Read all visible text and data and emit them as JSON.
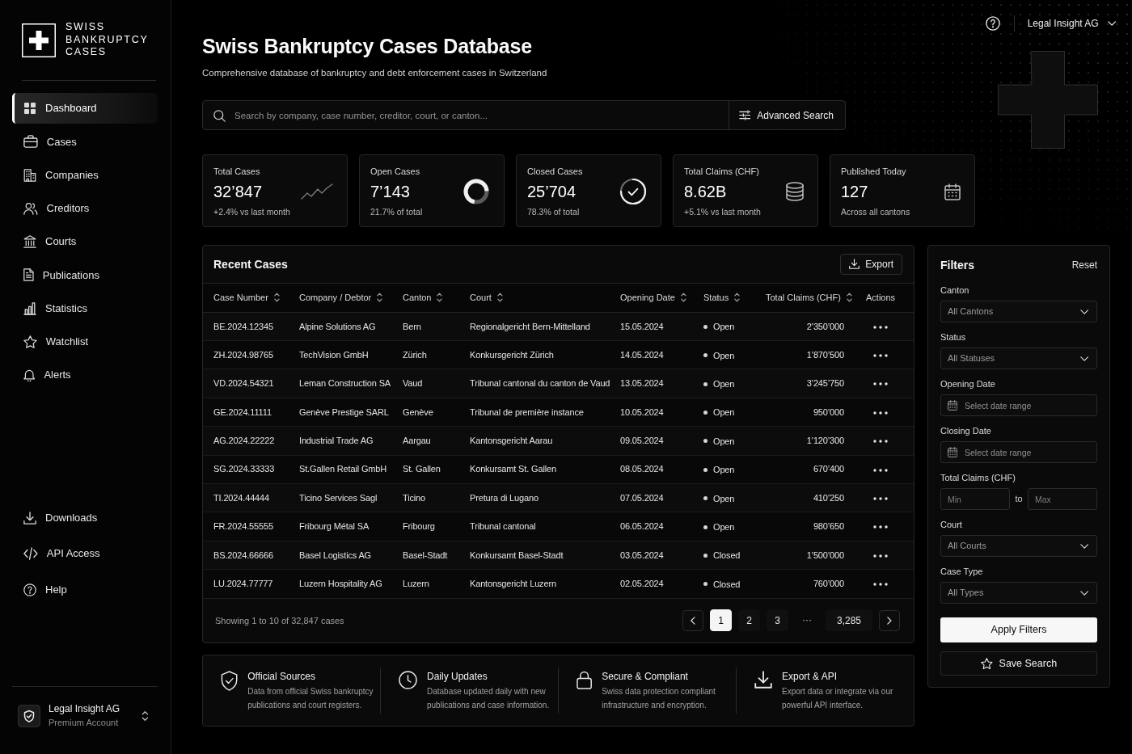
{
  "sidebar": {
    "logo_lines": [
      "SWISS",
      "BANKRUPTCY",
      "CASES"
    ],
    "nav_items": [
      {
        "label": "Dashboard",
        "selected": true
      },
      {
        "label": "Cases",
        "selected": false
      },
      {
        "label": "Companies",
        "selected": false
      },
      {
        "label": "Creditors",
        "selected": false
      },
      {
        "label": "Courts",
        "selected": false
      },
      {
        "label": "Publications",
        "selected": false
      },
      {
        "label": "Statistics",
        "selected": false
      },
      {
        "label": "Watchlist",
        "selected": false
      },
      {
        "label": "Alerts",
        "selected": false
      }
    ],
    "secondary_items": [
      {
        "label": "Downloads",
        "selected": false
      },
      {
        "label": "API Access",
        "selected": false
      },
      {
        "label": "Help",
        "selected": false
      }
    ],
    "account": {
      "name": "Legal Insight AG",
      "plan": "Premium Account"
    }
  },
  "top_bar": {
    "account_name": "Legal Insight AG"
  },
  "header": {
    "title": "Swiss Bankruptcy Cases Database",
    "subtitle": "Comprehensive database of bankruptcy and debt enforcement cases in Switzerland"
  },
  "search": {
    "placeholder": "Search by company, case number, creditor, court, or canton...",
    "advanced_button": "Advanced Search"
  },
  "stats": [
    {
      "label": "Total Cases",
      "value": "32’847",
      "note": "+2.4% vs last month"
    },
    {
      "label": "Open Cases",
      "value": "7’143",
      "note": "21.7% of total"
    },
    {
      "label": "Closed Cases",
      "value": "25’704",
      "note": "78.3% of total"
    },
    {
      "label": "Total Claims (CHF)",
      "value": "8.62B",
      "note": "+5.1% vs last month"
    },
    {
      "label": "Published Today",
      "value": "127",
      "note": "Across all cantons"
    }
  ],
  "table": {
    "title": "Recent Cases",
    "export_button": "Export",
    "columns": [
      {
        "label": "Case Number",
        "sortable": true
      },
      {
        "label": "Company / Debtor",
        "sortable": true
      },
      {
        "label": "Canton",
        "sortable": true
      },
      {
        "label": "Court",
        "sortable": true
      },
      {
        "label": "Opening Date",
        "sortable": true
      },
      {
        "label": "Status",
        "sortable": true
      },
      {
        "label": "Total Claims (CHF)",
        "sortable": true
      },
      {
        "label": "Actions",
        "sortable": false
      }
    ],
    "rows": [
      {
        "case_number": "BE.2024.12345",
        "company": "Alpine Solutions AG",
        "canton": "Bern",
        "court": "Regionalgericht Bern-Mittelland",
        "opening_date": "15.05.2024",
        "status": "Open",
        "total_claims": "2’350’000"
      },
      {
        "case_number": "ZH.2024.98765",
        "company": "TechVision GmbH",
        "canton": "Zürich",
        "court": "Konkursgericht Zürich",
        "opening_date": "14.05.2024",
        "status": "Open",
        "total_claims": "1’870’500"
      },
      {
        "case_number": "VD.2024.54321",
        "company": "Leman Construction SA",
        "canton": "Vaud",
        "court": "Tribunal cantonal du canton de Vaud",
        "opening_date": "13.05.2024",
        "status": "Open",
        "total_claims": "3’245’750"
      },
      {
        "case_number": "GE.2024.11111",
        "company": "Genève Prestige SARL",
        "canton": "Genève",
        "court": "Tribunal de première instance",
        "opening_date": "10.05.2024",
        "status": "Open",
        "total_claims": "950’000"
      },
      {
        "case_number": "AG.2024.22222",
        "company": "Industrial Trade AG",
        "canton": "Aargau",
        "court": "Kantonsgericht Aarau",
        "opening_date": "09.05.2024",
        "status": "Open",
        "total_claims": "1’120’300"
      },
      {
        "case_number": "SG.2024.33333",
        "company": "St.Gallen Retail GmbH",
        "canton": "St. Gallen",
        "court": "Konkursamt St. Gallen",
        "opening_date": "08.05.2024",
        "status": "Open",
        "total_claims": "670’400"
      },
      {
        "case_number": "TI.2024.44444",
        "company": "Ticino Services Sagl",
        "canton": "Ticino",
        "court": "Pretura di Lugano",
        "opening_date": "07.05.2024",
        "status": "Open",
        "total_claims": "410’250"
      },
      {
        "case_number": "FR.2024.55555",
        "company": "Fribourg Métal SA",
        "canton": "Fribourg",
        "court": "Tribunal cantonal",
        "opening_date": "06.05.2024",
        "status": "Open",
        "total_claims": "980’650"
      },
      {
        "case_number": "BS.2024.66666",
        "company": "Basel Logistics AG",
        "canton": "Basel-Stadt",
        "court": "Konkursamt Basel-Stadt",
        "opening_date": "03.05.2024",
        "status": "Closed",
        "total_claims": "1’500’000"
      },
      {
        "case_number": "LU.2024.77777",
        "company": "Luzern Hospitality AG",
        "canton": "Luzern",
        "court": "Kantonsgericht Luzern",
        "opening_date": "02.05.2024",
        "status": "Closed",
        "total_claims": "760’000"
      }
    ],
    "summary": "Showing 1 to 10 of 32,847 cases",
    "pages": [
      {
        "kind": "page",
        "label": "1",
        "selected": true
      },
      {
        "kind": "page",
        "label": "2",
        "selected": false
      },
      {
        "kind": "page",
        "label": "3",
        "selected": false
      },
      {
        "kind": "gap",
        "label": "···",
        "selected": false
      },
      {
        "kind": "page",
        "label": "3,285",
        "selected": false
      }
    ]
  },
  "filters": {
    "title": "Filters",
    "reset": "Reset",
    "fields": [
      {
        "kind": "select",
        "label": "Canton",
        "value": "All Cantons"
      },
      {
        "kind": "select",
        "label": "Status",
        "value": "All Statuses"
      },
      {
        "kind": "date",
        "label": "Opening Date",
        "placeholder": "Select date range"
      },
      {
        "kind": "date",
        "label": "Closing Date",
        "placeholder": "Select date range"
      },
      {
        "kind": "range",
        "label": "Total Claims (CHF)",
        "min_placeholder": "Min",
        "separator": "to",
        "max_placeholder": "Max"
      },
      {
        "kind": "select",
        "label": "Court",
        "value": "All Courts"
      },
      {
        "kind": "select",
        "label": "Case Type",
        "value": "All Types"
      }
    ],
    "apply_button": "Apply Filters",
    "save_button": "Save Search"
  },
  "features": [
    {
      "title": "Official Sources",
      "description": "Data from official Swiss bankruptcy publications and court registers."
    },
    {
      "title": "Daily Updates",
      "description": "Database updated daily with new publications and case information."
    },
    {
      "title": "Secure & Compliant",
      "description": "Swiss data protection compliant infrastructure and encryption."
    },
    {
      "title": "Export & API",
      "description": "Export data or integrate via our powerful API interface."
    }
  ]
}
